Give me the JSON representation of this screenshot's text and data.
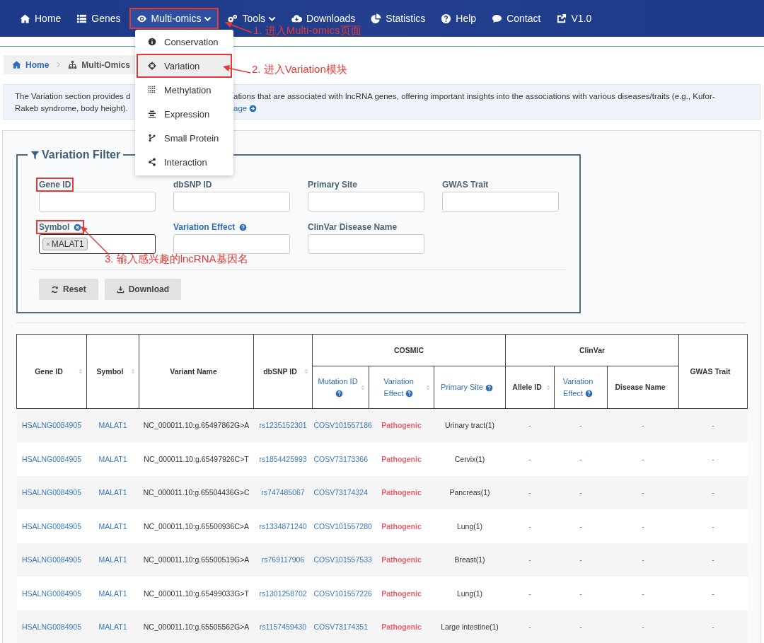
{
  "nav": {
    "items": [
      {
        "label": "Home",
        "selected": false,
        "caret": false,
        "highlighted": false
      },
      {
        "label": "Genes",
        "selected": false,
        "caret": false,
        "highlighted": false
      },
      {
        "label": "Multi-omics",
        "selected": true,
        "caret": true,
        "highlighted": true
      },
      {
        "label": "Tools",
        "selected": false,
        "caret": true,
        "highlighted": false
      },
      {
        "label": "Downloads",
        "selected": false,
        "caret": false,
        "highlighted": false
      },
      {
        "label": "Statistics",
        "selected": false,
        "caret": false,
        "highlighted": false
      },
      {
        "label": "Help",
        "selected": false,
        "caret": false,
        "highlighted": false
      },
      {
        "label": "Contact",
        "selected": false,
        "caret": false,
        "highlighted": false
      },
      {
        "label": "V1.0",
        "selected": false,
        "caret": false,
        "highlighted": false
      }
    ]
  },
  "menu": {
    "items": [
      {
        "label": "Conservation",
        "selected": false,
        "highlighted": false
      },
      {
        "label": "Variation",
        "selected": true,
        "highlighted": true
      },
      {
        "label": "Methylation",
        "selected": false,
        "highlighted": false
      },
      {
        "label": "Expression",
        "selected": false,
        "highlighted": false
      },
      {
        "label": "Small Protein",
        "selected": false,
        "highlighted": false
      },
      {
        "label": "Interaction",
        "selected": false,
        "highlighted": false
      }
    ]
  },
  "breadcrumb": [
    "Home",
    "Multi-Omics"
  ],
  "description": {
    "line_1_left": "The Variation section provides d",
    "line_1_right": "ations that are associated with lncRNA genes, offering important insights into the associations with various diseases/traits (e.g., Kufor-",
    "line_2_left": "Rakeb syndrome, body height).",
    "link": "age"
  },
  "filter": {
    "title": "Variation Filter",
    "fields": [
      {
        "label": "Gene ID",
        "kind": "text",
        "link": false,
        "help": false,
        "clear": false,
        "highlighted": true
      },
      {
        "label": "dbSNP ID",
        "kind": "text",
        "link": false,
        "help": false,
        "clear": false,
        "highlighted": false
      },
      {
        "label": "Primary Site",
        "kind": "text",
        "link": false,
        "help": false,
        "clear": false,
        "highlighted": false
      },
      {
        "label": "GWAS Trait",
        "kind": "text",
        "link": false,
        "help": false,
        "clear": false,
        "highlighted": false
      },
      {
        "label": "Symbol",
        "kind": "tags",
        "link": false,
        "help": false,
        "clear": true,
        "highlighted": true,
        "tags": [
          {
            "remove": "×",
            "label": "MALAT1"
          }
        ]
      },
      {
        "label": "Variation Effect",
        "kind": "text",
        "link": true,
        "help": true,
        "clear": false,
        "highlighted": false
      },
      {
        "label": "ClinVar Disease Name",
        "kind": "text",
        "link": false,
        "help": false,
        "clear": false,
        "highlighted": false
      }
    ],
    "buttons": [
      {
        "label": "Reset",
        "kind": "reset"
      },
      {
        "label": "Download",
        "kind": "download"
      }
    ]
  },
  "annotations": [
    {
      "text": "1. 进入Multi-omics页面",
      "kind": "nav"
    },
    {
      "text": "2. 进入Variation模块",
      "kind": "menu"
    },
    {
      "text": "3. 输入感兴趣的lncRNA基因名",
      "kind": "field"
    }
  ],
  "table": {
    "column_groups": [
      {
        "label": "COSMIC",
        "colspan": 3
      },
      {
        "label": "ClinVar",
        "colspan": 3
      }
    ],
    "columns": [
      {
        "label": "Gene ID",
        "grouped": false,
        "sortable": true,
        "help": false,
        "link": false,
        "kind": "link"
      },
      {
        "label": "Symbol",
        "grouped": false,
        "sortable": true,
        "help": false,
        "link": false,
        "kind": "link"
      },
      {
        "label": "Variant Name",
        "grouped": false,
        "sortable": false,
        "help": false,
        "link": false,
        "kind": "text"
      },
      {
        "label": "dbSNP ID",
        "grouped": false,
        "sortable": true,
        "help": false,
        "link": false,
        "kind": "link"
      },
      {
        "label": "Mutation ID",
        "grouped": true,
        "sortable": true,
        "help": true,
        "link": true,
        "kind": "link"
      },
      {
        "label": "Variation Effect",
        "grouped": true,
        "sortable": true,
        "help": true,
        "link": true,
        "kind": "danger"
      },
      {
        "label": "Primary Site",
        "grouped": true,
        "sortable": false,
        "help": true,
        "link": true,
        "kind": "text"
      },
      {
        "label": "Allele ID",
        "grouped": true,
        "sortable": true,
        "help": false,
        "link": false,
        "kind": "muted"
      },
      {
        "label": "Variation Effect",
        "grouped": true,
        "sortable": false,
        "help": true,
        "link": true,
        "kind": "link"
      },
      {
        "label": "Disease Name",
        "grouped": true,
        "sortable": false,
        "help": false,
        "link": false,
        "kind": "muted"
      },
      {
        "label": "GWAS Trait",
        "grouped": false,
        "sortable": false,
        "help": false,
        "link": false,
        "kind": "muted"
      }
    ],
    "rows": [
      [
        "HSALNG0084905",
        "MALAT1",
        "NC_000011.10:g.65497862G>A",
        "rs1235152301",
        "COSV101557186",
        "Pathogenic",
        "Urinary tract(1)",
        "-",
        "-",
        "-",
        "-"
      ],
      [
        "HSALNG0084905",
        "MALAT1",
        "NC_000011.10:g.65497926C>T",
        "rs1854425993",
        "COSV73173366",
        "Pathogenic",
        "Cervix(1)",
        "-",
        "-",
        "-",
        "-"
      ],
      [
        "HSALNG0084905",
        "MALAT1",
        "NC_000011.10:g.65504436G>C",
        "rs747485067",
        "COSV73174324",
        "Pathogenic",
        "Pancreas(1)",
        "-",
        "-",
        "-",
        "-"
      ],
      [
        "HSALNG0084905",
        "MALAT1",
        "NC_000011.10:g.65500936C>A",
        "rs1334871240",
        "COSV101557280",
        "Pathogenic",
        "Lung(1)",
        "-",
        "-",
        "-",
        "-"
      ],
      [
        "HSALNG0084905",
        "MALAT1",
        "NC_000011.10:g.65500519G>A",
        "rs769117906",
        "COSV101557533",
        "Pathogenic",
        "Breast(1)",
        "-",
        "-",
        "-",
        "-"
      ],
      [
        "HSALNG0084905",
        "MALAT1",
        "NC_000011.10:g.65499033G>T",
        "rs1301258702",
        "COSV101557226",
        "Pathogenic",
        "Lung(1)",
        "-",
        "-",
        "-",
        "-"
      ],
      [
        "HSALNG0084905",
        "MALAT1",
        "NC_000011.10:g.65505562G>A",
        "rs1157459430",
        "COSV73174351",
        "Pathogenic",
        "Large intestine(1)",
        "-",
        "-",
        "-",
        "-"
      ]
    ]
  }
}
